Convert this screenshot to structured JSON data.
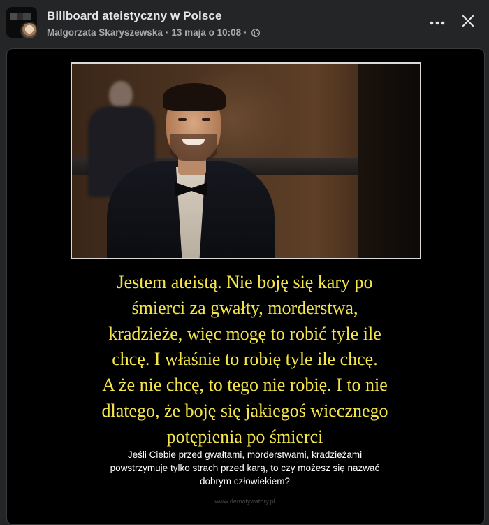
{
  "header": {
    "group_name": "Billboard ateistyczny w Polsce",
    "author": "Malgorzata Skaryszewska",
    "separator": "·",
    "timestamp": "13 maja o 10:08",
    "privacy_icon": "globe-icon",
    "more_icon": "more-horizontal-icon",
    "close_icon": "close-icon"
  },
  "post": {
    "caption_lines": [
      "Jestem ateistą. Nie boję się kary po",
      "śmierci za gwałty, morderstwa,",
      "kradzieże, więc mogę to robić tyle ile",
      "chcę. I właśnie to robię tyle ile chcę.",
      "A że nie chcę, to tego nie robię. I to nie",
      "dlatego, że boję się jakiegoś wiecznego",
      "potępienia po śmierci"
    ],
    "subcaption_lines": [
      "Jeśli Ciebie przed gwałtami, morderstwami, kradzieżami",
      "powstrzymuje tylko strach przed karą, to czy możesz się nazwać",
      "dobrym człowiekiem?"
    ],
    "watermark": "www.demotywatory.pl"
  },
  "colors": {
    "background": "#242526",
    "caption": "#f4e64a",
    "subcaption": "#ffffff",
    "meta_text": "#a8abaf"
  }
}
